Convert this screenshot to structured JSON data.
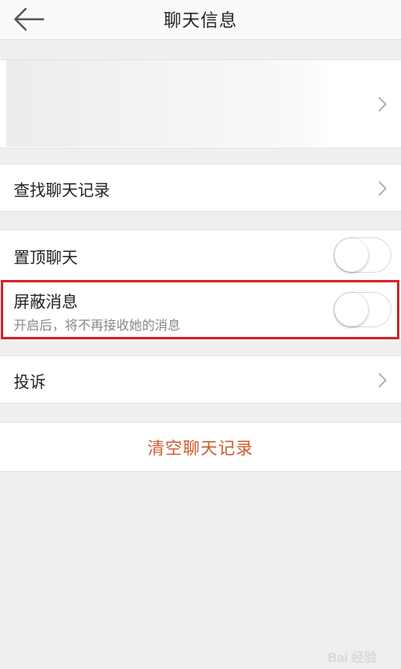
{
  "header": {
    "title": "聊天信息",
    "back_icon": "arrow-left-icon"
  },
  "profile": {
    "chevron_icon": "chevron-right-icon"
  },
  "search_history": {
    "label": "查找聊天记录",
    "chevron_icon": "chevron-right-icon"
  },
  "pin_chat": {
    "label": "置顶聊天",
    "enabled": false
  },
  "block_messages": {
    "label": "屏蔽消息",
    "description": "开启后，将不再接收她的消息",
    "enabled": false
  },
  "complaint": {
    "label": "投诉",
    "chevron_icon": "chevron-right-icon"
  },
  "clear_history": {
    "label": "清空聊天记录"
  },
  "watermark": {
    "text": "Bai 经验"
  },
  "colors": {
    "highlight": "#d4232a",
    "clear_text": "#d05a2e",
    "background": "#efeff0"
  }
}
